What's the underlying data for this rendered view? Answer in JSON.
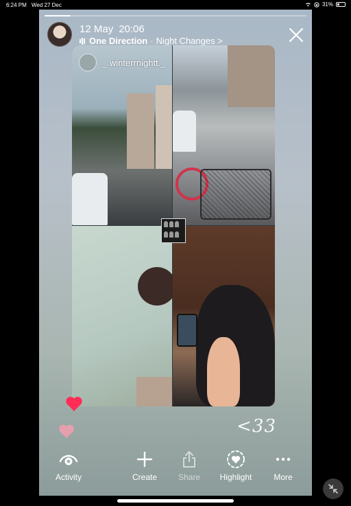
{
  "status_bar": {
    "time": "6:24 PM",
    "date": "Wed 27 Dec",
    "battery": "31%",
    "battery_level": 0.31
  },
  "story": {
    "progress_fraction": 0.1,
    "header": {
      "date": "12 May",
      "time": "20:06",
      "artist": "One Direction",
      "separator": "·",
      "song": "Night Changes >"
    },
    "mention": {
      "username": "_.winterrnightt._"
    },
    "caption": "<33",
    "actions": [
      {
        "label": "Activity",
        "icon": "activity-eye-icon",
        "enabled": true
      },
      {
        "label": "Create",
        "icon": "plus-icon",
        "enabled": true
      },
      {
        "label": "Share",
        "icon": "share-icon",
        "enabled": false
      },
      {
        "label": "Highlight",
        "icon": "highlight-heart-icon",
        "enabled": true
      },
      {
        "label": "More",
        "icon": "more-dots-icon",
        "enabled": true
      }
    ]
  },
  "colors": {
    "like_red": "#ff2d55",
    "like_pink": "#e6a0ad",
    "close": "#ffffff"
  }
}
